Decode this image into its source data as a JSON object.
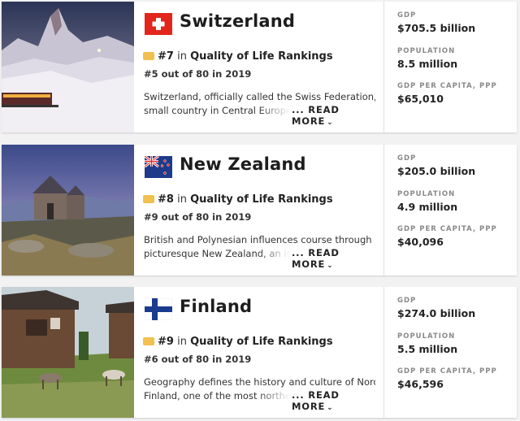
{
  "countries": [
    {
      "name": "Switzerland",
      "flag_icon": "switzerland-flag-icon",
      "rank": "#7",
      "in_text": "in",
      "category": "Quality of Life Rankings",
      "previous": "#5 out of 80 in 2019",
      "desc_line1": "Switzerland, officially called the Swiss Federation, is a",
      "desc_line2": "small country in Central Europe ma",
      "read_more": "... READ MORE",
      "gdp_label": "GDP",
      "gdp": "$705.5 billion",
      "pop_label": "POPULATION",
      "population": "8.5 million",
      "gdppc_label": "GDP PER CAPITA, PPP",
      "gdp_per_capita": "$65,010"
    },
    {
      "name": "New Zealand",
      "flag_icon": "new-zealand-flag-icon",
      "rank": "#8",
      "in_text": "in",
      "category": "Quality of Life Rankings",
      "previous": "#9 out of 80 in 2019",
      "desc_line1": "British and Polynesian influences course through",
      "desc_line2": "picturesque New Zealand, an islan",
      "read_more": "... READ MORE",
      "gdp_label": "GDP",
      "gdp": "$205.0 billion",
      "pop_label": "POPULATION",
      "population": "4.9 million",
      "gdppc_label": "GDP PER CAPITA, PPP",
      "gdp_per_capita": "$40,096"
    },
    {
      "name": "Finland",
      "flag_icon": "finland-flag-icon",
      "rank": "#9",
      "in_text": "in",
      "category": "Quality of Life Rankings",
      "previous": "#6 out of 80 in 2019",
      "desc_line1": "Geography defines the history and culture of Nordic",
      "desc_line2": "Finland, one of the most northern",
      "read_more": "... READ MORE",
      "gdp_label": "GDP",
      "gdp": "$274.0 billion",
      "pop_label": "POPULATION",
      "population": "5.5 million",
      "gdppc_label": "GDP PER CAPITA, PPP",
      "gdp_per_capita": "$46,596"
    }
  ],
  "colors": {
    "swiss_red": "#e2261b",
    "nz_blue": "#1f3a8a",
    "fin_blue": "#1a3c8f",
    "medal": "#f2c04e"
  }
}
